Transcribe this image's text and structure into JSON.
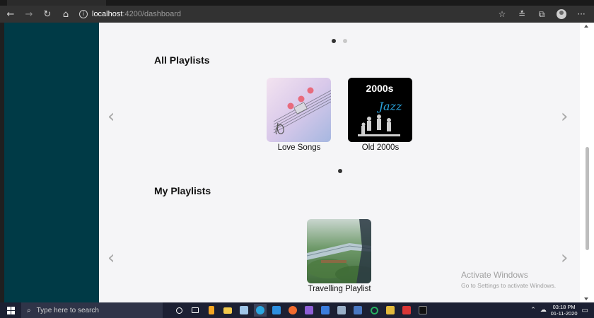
{
  "browser": {
    "url_host": "localhost",
    "url_path": ":4200/dashboard"
  },
  "all_playlists": {
    "title": "All Playlists",
    "items": [
      {
        "label": "Love Songs"
      },
      {
        "label": "Old 2000s",
        "thumb_text": "2000s",
        "thumb_script": "Jazz"
      }
    ]
  },
  "my_playlists": {
    "title": "My Playlists",
    "items": [
      {
        "label": "Travelling Playlist"
      }
    ]
  },
  "watermark": {
    "line1": "Activate Windows",
    "line2": "Go to Settings to activate Windows."
  },
  "taskbar": {
    "search_placeholder": "Type here to search",
    "time": "03:18 PM",
    "date": "01-11-2020"
  },
  "colors": {
    "sidebar": "#003a46",
    "content_bg": "#f5f5f7",
    "taskbar": "#1c2033"
  }
}
